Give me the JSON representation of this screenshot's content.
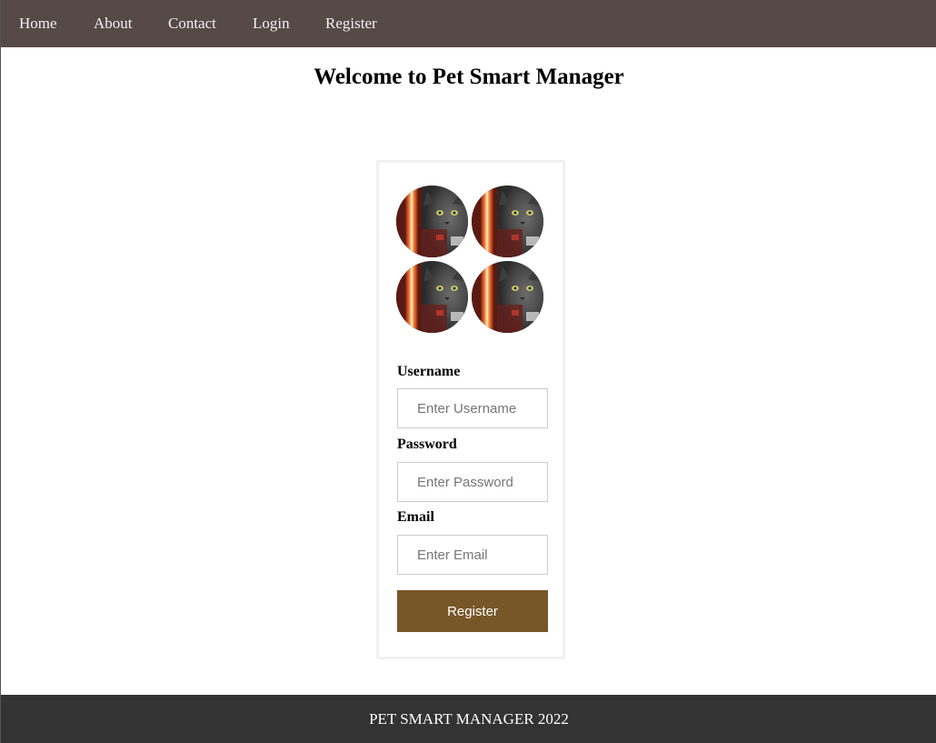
{
  "nav": {
    "items": [
      {
        "label": "Home"
      },
      {
        "label": "About"
      },
      {
        "label": "Contact"
      },
      {
        "label": "Login"
      },
      {
        "label": "Register"
      }
    ]
  },
  "page": {
    "title": "Welcome to Pet Smart Manager"
  },
  "form": {
    "avatar_icon": "cat-photo-icon",
    "username": {
      "label": "Username",
      "placeholder": "Enter Username",
      "value": ""
    },
    "password": {
      "label": "Password",
      "placeholder": "Enter Password",
      "value": ""
    },
    "email": {
      "label": "Email",
      "placeholder": "Enter Email",
      "value": ""
    },
    "submit_label": "Register"
  },
  "footer": {
    "text": "PET SMART MANAGER 2022"
  },
  "colors": {
    "navbar_bg": "#564a47",
    "button_bg": "#775628",
    "footer_bg": "#333333"
  }
}
